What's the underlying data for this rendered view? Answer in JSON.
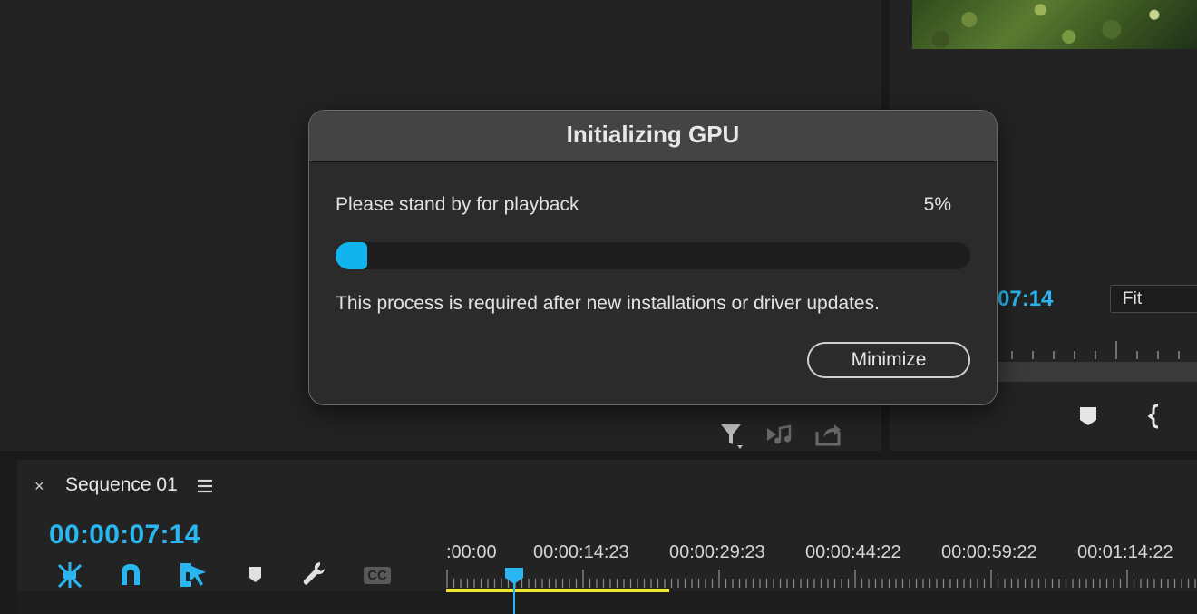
{
  "colors": {
    "accent_blue": "#2ab6f0",
    "progress_fill": "#12b4ee",
    "work_area": "#f2e534",
    "panel_bg": "#232323"
  },
  "project_panel": {
    "icons": [
      "filter-icon",
      "automate-to-sequence-icon",
      "export-icon"
    ]
  },
  "program_monitor": {
    "timecode": "07:14",
    "zoom_value": "Fit",
    "icons": [
      "marker-icon",
      "mark-in-icon"
    ]
  },
  "timeline": {
    "close_glyph": "×",
    "title": "Sequence 01",
    "timecode": "00:00:07:14",
    "ruler_labels": [
      ":00:00",
      "00:00:14:23",
      "00:00:29:23",
      "00:00:44:22",
      "00:00:59:22",
      "00:01:14:22"
    ],
    "tools": [
      {
        "name": "snap-in-timeline-icon"
      },
      {
        "name": "linked-selection-magnet-icon"
      },
      {
        "name": "insert-overwrite-icon"
      },
      {
        "name": "add-marker-icon"
      },
      {
        "name": "timeline-settings-wrench-icon"
      },
      {
        "name": "captions-cc-icon",
        "label": "CC"
      }
    ]
  },
  "dialog": {
    "title": "Initializing GPU",
    "status": "Please stand by for playback",
    "percent_label": "5%",
    "progress_fraction": 0.05,
    "info": "This process is required after new installations or driver updates.",
    "minimize_label": "Minimize"
  }
}
